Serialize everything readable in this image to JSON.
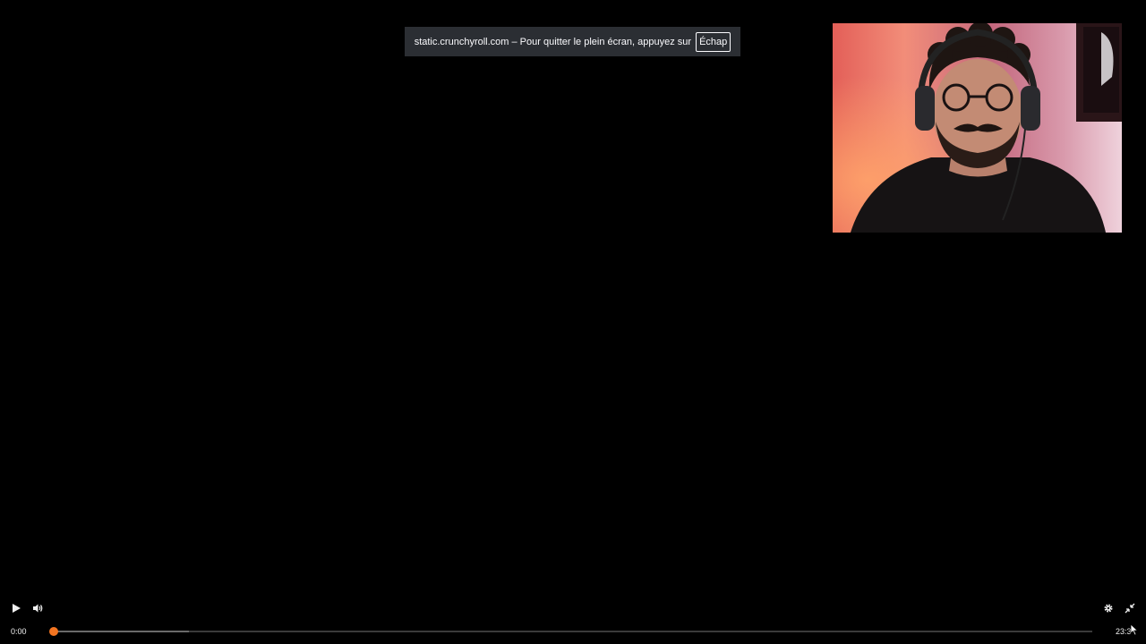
{
  "fullscreen_notice": {
    "message": "static.crunchyroll.com – Pour quitter le plein écran, appuyez sur",
    "key": "Échap"
  },
  "player": {
    "current_time": "0:00",
    "duration": "23:3",
    "progress_fraction": 0.0,
    "buffered_fraction": 0.13,
    "accent_color": "#f47521",
    "icons": {
      "play": "play-icon",
      "volume": "volume-icon",
      "settings": "gear-icon",
      "exit_fullscreen": "exit-fullscreen-icon"
    }
  }
}
